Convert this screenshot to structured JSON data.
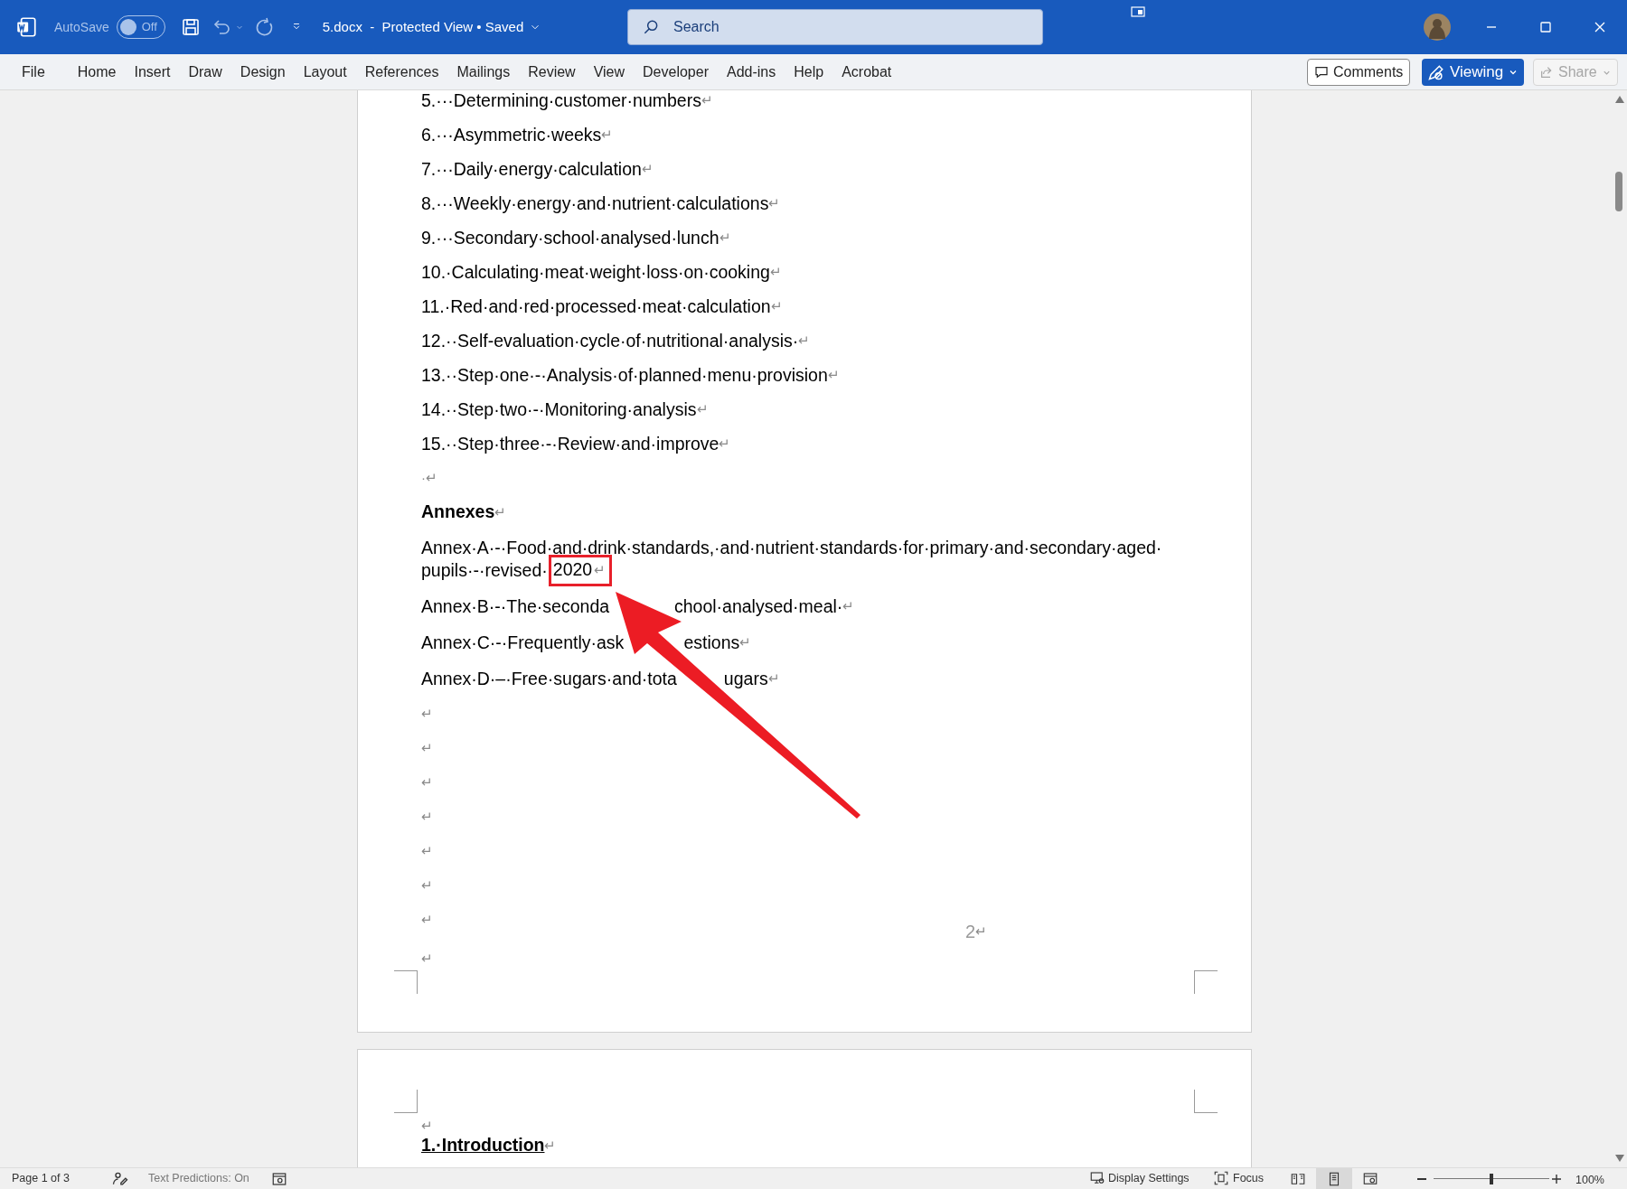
{
  "title_bar": {
    "autosave_label": "AutoSave",
    "autosave_on": false,
    "autosave_state": "Off",
    "document_title": "5.docx  -  Protected View • Saved",
    "search": {
      "placeholder": "Search"
    }
  },
  "ribbon_tabs": [
    {
      "label": "File",
      "selected": false
    },
    {
      "label": "Home",
      "selected": false
    },
    {
      "label": "Insert",
      "selected": false
    },
    {
      "label": "Draw",
      "selected": false
    },
    {
      "label": "Design",
      "selected": false
    },
    {
      "label": "Layout",
      "selected": false
    },
    {
      "label": "References",
      "selected": false
    },
    {
      "label": "Mailings",
      "selected": false
    },
    {
      "label": "Review",
      "selected": false
    },
    {
      "label": "View",
      "selected": false
    },
    {
      "label": "Developer",
      "selected": false
    },
    {
      "label": "Add-ins",
      "selected": false
    },
    {
      "label": "Help",
      "selected": false
    },
    {
      "label": "Acrobat",
      "selected": false
    }
  ],
  "ribbon_buttons": {
    "comments": "Comments",
    "viewing": "Viewing",
    "share": {
      "label": "Share",
      "disabled": true
    }
  },
  "page_1": {
    "paragraphs": [
      {
        "kind": "list",
        "text": "5.···Determining·customer·numbers",
        "mark": "↵"
      },
      {
        "kind": "list",
        "text": "6.···Asymmetric·weeks",
        "mark": "↵"
      },
      {
        "kind": "list",
        "text": "7.···Daily·energy·calculation",
        "mark": "↵"
      },
      {
        "kind": "list",
        "text": "8.···Weekly·energy·and·nutrient·calculations",
        "mark": "↵"
      },
      {
        "kind": "list",
        "text": "9.···Secondary·school·analysed·lunch",
        "mark": "↵"
      },
      {
        "kind": "list",
        "text": "10.·Calculating·meat·weight·loss·on·cooking",
        "mark": "↵"
      },
      {
        "kind": "list",
        "text": "11.·Red·and·red·processed·meat·calculation",
        "mark": "↵"
      },
      {
        "kind": "list",
        "text": "12.··Self-evaluation·cycle·of·nutritional·analysis·",
        "mark": "↵"
      },
      {
        "kind": "list",
        "text": "13.··Step·one·-·Analysis·of·planned·menu·provision",
        "mark": "↵"
      },
      {
        "kind": "list",
        "text": "14.··Step·two·-·Monitoring·analysis",
        "mark": "↵"
      },
      {
        "kind": "list",
        "text": "15.··Step·three·-·Review·and·improve",
        "mark": "↵"
      },
      {
        "kind": "empty",
        "text": "·",
        "mark": "↵"
      },
      {
        "kind": "heading",
        "text": "Annexes",
        "mark": "↵"
      },
      {
        "kind": "annex",
        "lines": [
          [
            "Annex·A·-·Food·and·drink·standards,·and·nutrient·standards·for·primary·and·secondary·aged·"
          ],
          [
            "pupils·-·revised·"
          ]
        ],
        "highlight": "2020",
        "mark": "↵"
      },
      {
        "kind": "annex",
        "lines": [
          [
            "Annex·B·-·The·seconda",
            "chool·analysed·meal·"
          ]
        ],
        "mark": "↵"
      },
      {
        "kind": "annex",
        "lines": [
          [
            "Annex·C·-·Frequently·ask",
            "estions"
          ]
        ],
        "mark": "↵"
      },
      {
        "kind": "annex",
        "lines": [
          [
            "Annex·D·–·Free·sugars·and·tota",
            "ugars"
          ]
        ],
        "mark": "↵"
      },
      {
        "kind": "empty",
        "mark": "↵"
      },
      {
        "kind": "empty",
        "mark": "↵"
      },
      {
        "kind": "empty",
        "mark": "↵"
      },
      {
        "kind": "empty",
        "mark": "↵"
      },
      {
        "kind": "empty",
        "mark": "↵"
      },
      {
        "kind": "empty",
        "mark": "↵"
      },
      {
        "kind": "empty",
        "mark": "↵"
      }
    ],
    "page_number": "2",
    "page_number_mark": "↵",
    "last_mark": "↵"
  },
  "page_2": {
    "first_mark": "↵",
    "heading": "1.·Introduction",
    "heading_mark": "↵"
  },
  "status_bar": {
    "page": "Page 1 of 3",
    "text_predictions": "Text Predictions: On",
    "display_settings": "Display Settings",
    "focus": "Focus",
    "views": [
      {
        "kind": "read",
        "selected": false
      },
      {
        "kind": "print",
        "selected": true
      },
      {
        "kind": "web",
        "selected": false
      }
    ],
    "zoom_slider": {
      "level": 0.5
    },
    "zoom": "100%"
  }
}
